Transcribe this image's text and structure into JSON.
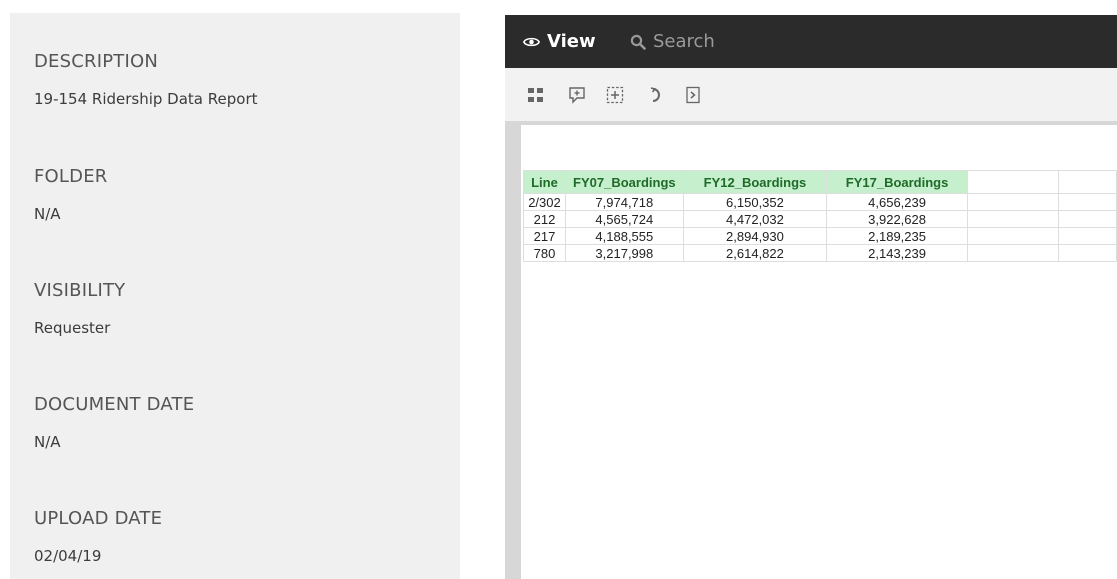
{
  "metadata": {
    "fields": [
      {
        "label": "DESCRIPTION",
        "value": "19-154 Ridership Data Report"
      },
      {
        "label": "FOLDER",
        "value": "N/A"
      },
      {
        "label": "VISIBILITY",
        "value": "Requester"
      },
      {
        "label": "DOCUMENT DATE",
        "value": "N/A"
      },
      {
        "label": "UPLOAD DATE",
        "value": "02/04/19"
      }
    ]
  },
  "viewer": {
    "tabs": [
      {
        "label": "View",
        "icon": "eye-icon",
        "active": true
      },
      {
        "label": "Search",
        "icon": "search-icon",
        "active": false
      }
    ],
    "toolbar": {
      "tools": [
        {
          "icon": "thumbnails-icon"
        },
        {
          "icon": "comment-icon"
        },
        {
          "icon": "zoom-fit-icon"
        },
        {
          "icon": "rotate-icon"
        },
        {
          "icon": "export-page-icon"
        }
      ]
    },
    "table": {
      "headers": [
        "Line",
        "FY07_Boardings",
        "FY12_Boardings",
        "FY17_Boardings"
      ],
      "rows": [
        [
          "2/302",
          "7,974,718",
          "6,150,352",
          "4,656,239"
        ],
        [
          "212",
          "4,565,724",
          "4,472,032",
          "3,922,628"
        ],
        [
          "217",
          "4,188,555",
          "2,894,930",
          "2,189,235"
        ],
        [
          "780",
          "3,217,998",
          "2,614,822",
          "2,143,239"
        ]
      ]
    }
  },
  "colors": {
    "tab_bar": "#2b2b2b",
    "header_fill": "#c6efce",
    "header_text": "#1f6b28",
    "panel": "#f0f0f0"
  }
}
